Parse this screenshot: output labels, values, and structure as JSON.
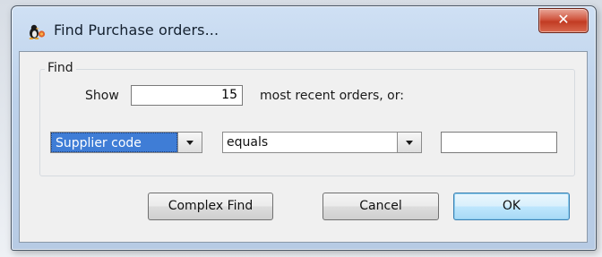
{
  "window": {
    "title": "Find Purchase orders...",
    "app_icon": "penguin-app-icon",
    "close_label": "✕"
  },
  "find_group": {
    "label": "Find",
    "show_label": "Show",
    "count_value": "15",
    "recent_label": "most recent orders, or:"
  },
  "criteria": {
    "field_selected": "Supplier code",
    "operator_selected": "equals",
    "value": ""
  },
  "buttons": {
    "complex_find": "Complex Find",
    "cancel": "Cancel",
    "ok": "OK"
  },
  "colors": {
    "selection": "#3f7dd6",
    "default_button_border": "#3c7fb1",
    "close_button": "#c23b23"
  }
}
